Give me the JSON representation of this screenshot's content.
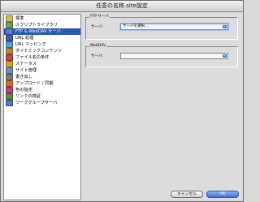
{
  "window": {
    "title": "任意の名称.site設定"
  },
  "sidebar": {
    "items": [
      {
        "label": "標準",
        "icon": "folder-icon",
        "color": "#d7b65a"
      },
      {
        "label": "スクリプトライブラリ",
        "icon": "script-library-icon",
        "color": "#6aa84f"
      },
      {
        "label": "FTP & WebDAV サーバ",
        "icon": "server-icon",
        "color": "#5b7fd1",
        "selected": true
      },
      {
        "label": "URL 処理",
        "icon": "url-icon",
        "color": "#3d5fa8"
      },
      {
        "label": "URL マッピング",
        "icon": "url-mapping-icon",
        "color": "#4aa0d8"
      },
      {
        "label": "ダイナミックコンテンツ",
        "icon": "gear-icon",
        "color": "#b58a3a"
      },
      {
        "label": "ファイル名の条件",
        "icon": "file-filter-icon",
        "color": "#c44"
      },
      {
        "label": "ステータス",
        "icon": "status-icon",
        "color": "#d2a12a"
      },
      {
        "label": "サイト管理",
        "icon": "site-icon",
        "color": "#6a8fc4"
      },
      {
        "label": "書き出し",
        "icon": "export-icon",
        "color": "#7b7b7b"
      },
      {
        "label": "アップロード / 同期",
        "icon": "upload-icon",
        "color": "#d36b2a"
      },
      {
        "label": "色の指定",
        "icon": "color-icon",
        "color": "#c13b8b"
      },
      {
        "label": "リンクの検証",
        "icon": "link-check-icon",
        "color": "#5a8c3a"
      },
      {
        "label": "ワークグループサーバ",
        "icon": "workgroup-icon",
        "color": "#4d7cc8"
      }
    ]
  },
  "ftp": {
    "legend": "FTP サーバ",
    "server_label": "サーバ:",
    "server_value": "サーバを選択..."
  },
  "webdav": {
    "legend": "WebDAV",
    "server_label": "サーバ:",
    "server_value": ""
  },
  "buttons": {
    "cancel": "キャンセル",
    "ok": "OK"
  }
}
